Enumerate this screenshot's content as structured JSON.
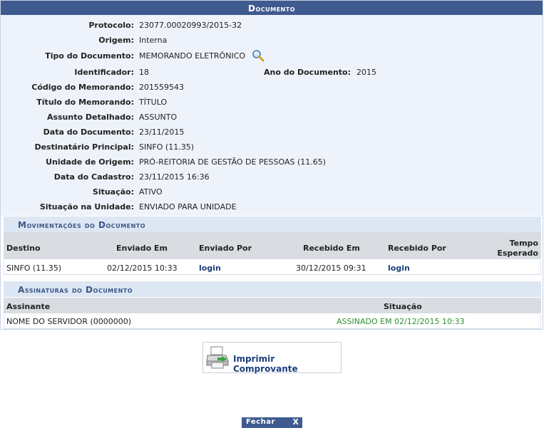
{
  "panel": {
    "title": "Documento"
  },
  "fields": [
    {
      "label": "Protocolo:",
      "value": "23077.00020993/2015-32"
    },
    {
      "label": "Origem:",
      "value": "Interna"
    },
    {
      "label": "Tipo do Documento:",
      "value": "MEMORANDO ELETRÔNICO"
    },
    {
      "label": "Identificador:",
      "value": "18",
      "label2": "Ano do Documento:",
      "value2": "2015"
    },
    {
      "label": "Código do Memorando:",
      "value": "201559543"
    },
    {
      "label": "Título do Memorando:",
      "value": "TÍTULO"
    },
    {
      "label": "Assunto Detalhado:",
      "value": "ASSUNTO"
    },
    {
      "label": "Data do Documento:",
      "value": "23/11/2015"
    },
    {
      "label": "Destinatário Principal:",
      "value": "SINFO (11.35)"
    },
    {
      "label": "Unidade de Origem:",
      "value": "PRÓ-REITORIA DE GESTÃO DE PESSOAS (11.65)"
    },
    {
      "label": "Data do Cadastro:",
      "value": "23/11/2015 16:36"
    },
    {
      "label": "Situação:",
      "value": "ATIVO"
    },
    {
      "label": "Situação na Unidade:",
      "value": "ENVIADO PARA UNIDADE"
    }
  ],
  "movimentacoes": {
    "title": "Movimentações do Documento",
    "headers": [
      "Destino",
      "Enviado Em",
      "Enviado Por",
      "Recebido Em",
      "Recebido Por",
      "Tempo",
      "Esperado"
    ],
    "rows": [
      {
        "destino": "SINFO (11.35)",
        "enviado_em": "02/12/2015 10:33",
        "enviado_por": "login",
        "recebido_em": "30/12/2015 09:31",
        "recebido_por": "login",
        "tempo": ""
      }
    ]
  },
  "assinaturas": {
    "title": "Assinaturas do Documento",
    "headers": [
      "Assinante",
      "Situação"
    ],
    "rows": [
      {
        "assinante": "NOME DO SERVIDOR (0000000)",
        "situacao": "ASSINADO EM 02/12/2015 10:33"
      }
    ]
  },
  "actions": {
    "print_label": "Imprimir Comprovante",
    "close_label": "Fechar",
    "close_x": "X"
  },
  "colors": {
    "header": "#3e5a8f",
    "section": "#dde7f3",
    "link": "#1c3f7c",
    "signed": "#2f8f2f"
  },
  "icons": {
    "tipo": "magnifier-icon",
    "print": "printer-icon"
  }
}
